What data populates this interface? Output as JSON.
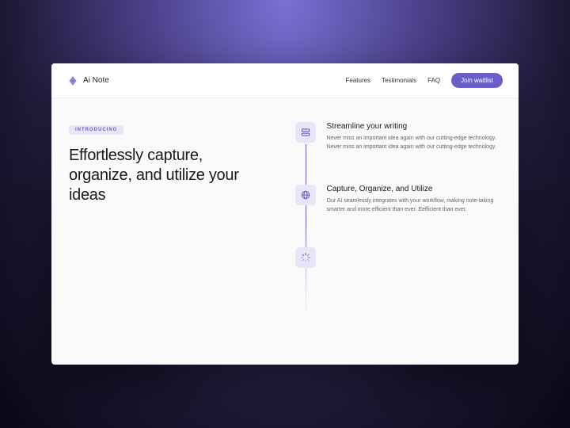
{
  "header": {
    "brand": "Ai Note",
    "nav": {
      "features": "Features",
      "testimonials": "Testimonials",
      "faq": "FAQ"
    },
    "cta": "Join waitlist"
  },
  "hero": {
    "badge": "INTRODUCING",
    "headline": "Effortlessly capture, organize, and utilize your ideas"
  },
  "features": [
    {
      "title": "Streamline your writing",
      "desc": "Never miss an important idea again with our cutting-edge technology. Never miss an important idea again with our cutting-edge technology."
    },
    {
      "title": "Capture, Organize, and Utilize",
      "desc": "Our AI seamlessly integrates with your workflow, making note-taking smarter and more efficient than ever. Eefficient than ever."
    }
  ]
}
